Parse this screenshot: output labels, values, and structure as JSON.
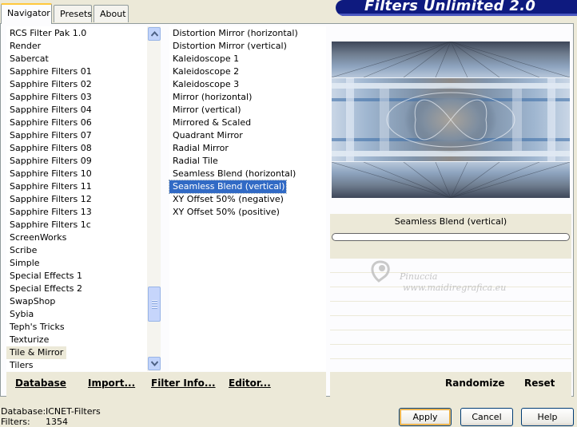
{
  "tabs": [
    "Navigator",
    "Presets",
    "About"
  ],
  "banner_title": "Filters Unlimited 2.0",
  "categories": [
    "RCS Filter Pak 1.0",
    "Render",
    "Sabercat",
    "Sapphire Filters 01",
    "Sapphire Filters 02",
    "Sapphire Filters 03",
    "Sapphire Filters 04",
    "Sapphire Filters 06",
    "Sapphire Filters 07",
    "Sapphire Filters 08",
    "Sapphire Filters 09",
    "Sapphire Filters 10",
    "Sapphire Filters 11",
    "Sapphire Filters 12",
    "Sapphire Filters 13",
    "Sapphire Filters 1c",
    "ScreenWorks",
    "Scribe",
    "Simple",
    "Special Effects 1",
    "Special Effects 2",
    "SwapShop",
    "Sybia",
    "Teph's Tricks",
    "Texturize",
    "Tile & Mirror",
    "Tilers"
  ],
  "selected_category": "Tile & Mirror",
  "filters": [
    "Distortion Mirror (horizontal)",
    "Distortion Mirror (vertical)",
    "Kaleidoscope 1",
    "Kaleidoscope 2",
    "Kaleidoscope 3",
    "Mirror (horizontal)",
    "Mirror (vertical)",
    "Mirrored & Scaled",
    "Quadrant Mirror",
    "Radial Mirror",
    "Radial Tile",
    "Seamless Blend (horizontal)",
    "Seamless Blend (vertical)",
    "XY Offset 50% (negative)",
    "XY Offset 50% (positive)"
  ],
  "selected_filter": "Seamless Blend (vertical)",
  "preview_filter_name": "Seamless Blend (vertical)",
  "progress": 0,
  "watermark": {
    "name": "Pinuccia",
    "url": "www.maidiregrafica.eu"
  },
  "toolbar": {
    "database": "Database",
    "import": "Import...",
    "filter_info": "Filter Info...",
    "editor": "Editor...",
    "randomize": "Randomize",
    "reset": "Reset"
  },
  "status": {
    "database_label": "Database:",
    "database_value": "ICNET-Filters",
    "filters_label": "Filters:",
    "filters_value": "1354"
  },
  "dialog": {
    "apply": "Apply",
    "cancel": "Cancel",
    "help": "Help"
  },
  "colors": {
    "selection": "#316ac5",
    "banner": "#0e1a7f",
    "face": "#ece9d8",
    "tab_accent": "#ffc83c"
  }
}
